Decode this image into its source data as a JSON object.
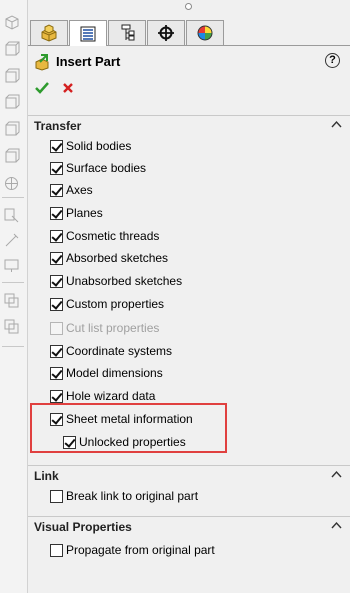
{
  "panel": {
    "title": "Insert Part",
    "help": "?",
    "tabs": [
      {
        "icon": "feature-manager-icon",
        "active": false
      },
      {
        "icon": "property-manager-icon",
        "active": true
      },
      {
        "icon": "configuration-manager-icon",
        "active": false
      },
      {
        "icon": "dimxpert-manager-icon",
        "active": false
      },
      {
        "icon": "display-manager-icon",
        "active": false
      }
    ]
  },
  "sections": {
    "transfer": {
      "label": "Transfer",
      "items": [
        {
          "label": "Solid bodies",
          "checked": true,
          "enabled": true
        },
        {
          "label": "Surface bodies",
          "checked": true,
          "enabled": true
        },
        {
          "label": "Axes",
          "checked": true,
          "enabled": true
        },
        {
          "label": "Planes",
          "checked": true,
          "enabled": true
        },
        {
          "label": "Cosmetic threads",
          "checked": true,
          "enabled": true
        },
        {
          "label": "Absorbed sketches",
          "checked": true,
          "enabled": true
        },
        {
          "label": "Unabsorbed sketches",
          "checked": true,
          "enabled": true
        },
        {
          "label": "Custom properties",
          "checked": true,
          "enabled": true
        },
        {
          "label": "Cut list properties",
          "checked": false,
          "enabled": false
        },
        {
          "label": "Coordinate systems",
          "checked": true,
          "enabled": true
        },
        {
          "label": "Model dimensions",
          "checked": true,
          "enabled": true
        },
        {
          "label": "Hole wizard data",
          "checked": true,
          "enabled": true
        },
        {
          "label": "Sheet metal information",
          "checked": true,
          "enabled": true
        },
        {
          "label": "Unlocked properties",
          "checked": true,
          "enabled": true
        }
      ]
    },
    "link": {
      "label": "Link",
      "items": [
        {
          "label": "Break link to original part",
          "checked": false,
          "enabled": true
        }
      ]
    },
    "visual": {
      "label": "Visual Properties",
      "items": [
        {
          "label": "Propagate from original part",
          "checked": false,
          "enabled": true
        }
      ]
    }
  },
  "colors": {
    "highlight": "#e0403f",
    "ok": "#2e9b2e",
    "cancel": "#d42020"
  }
}
